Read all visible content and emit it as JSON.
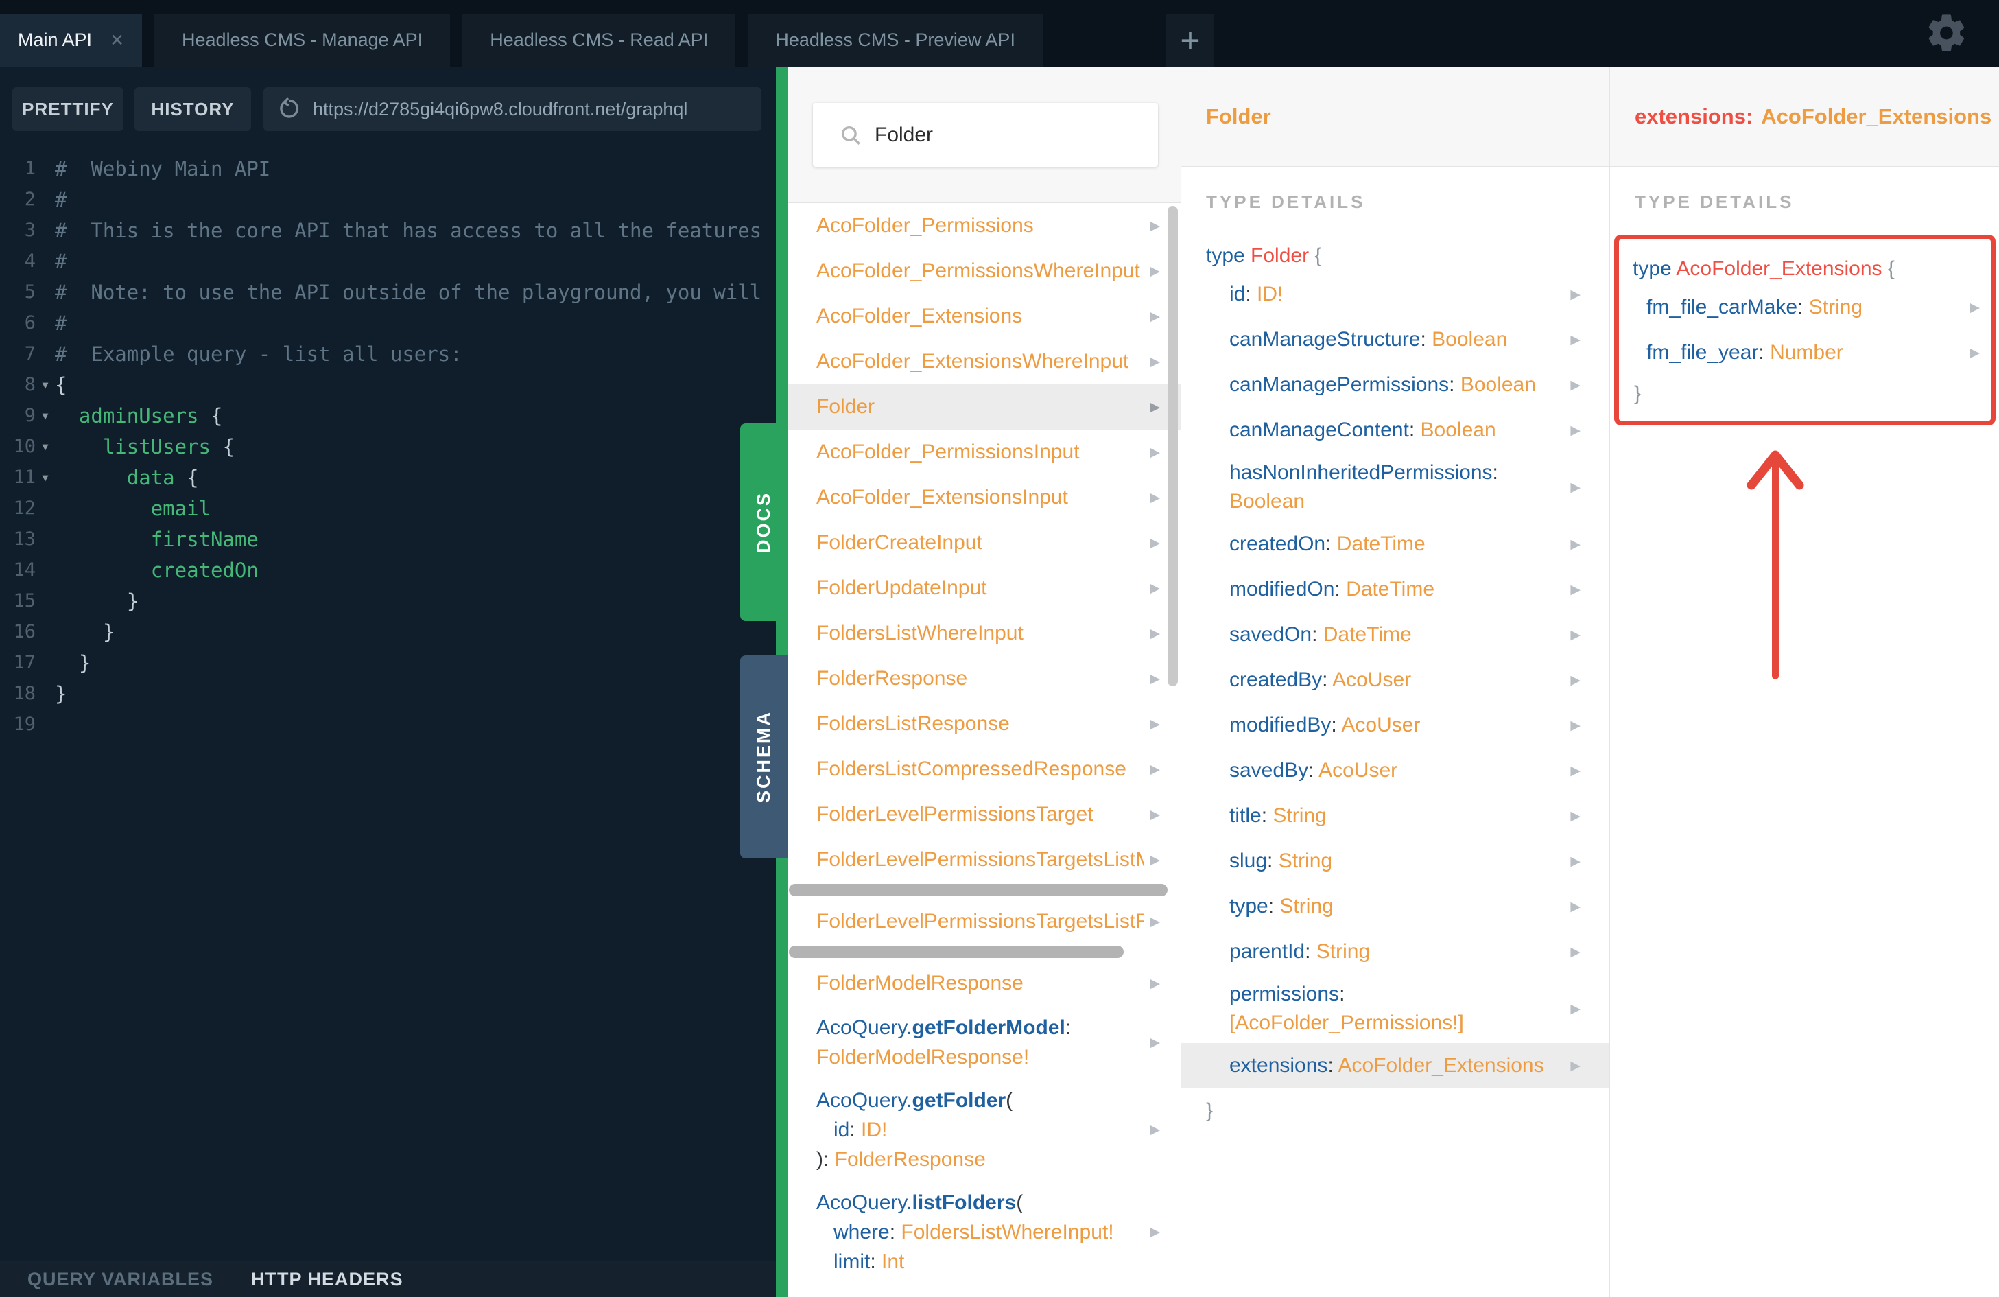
{
  "colors": {
    "green": "#2aa35f",
    "schema": "#3e5973",
    "orange": "#ed9c42",
    "blue": "#1f61a0",
    "red": "#f04e42",
    "boxred": "#e8463a",
    "editor-bg": "#0f1e2a",
    "topbar-bg": "#0a131c",
    "panel-bg": "#f7f7f7",
    "sel": "#ececec",
    "codegreen": "#45b878",
    "comment": "#5f7484"
  },
  "glyphs": {
    "chevron": "▶",
    "fold": "▼",
    "close": "✕",
    "brace_open": "{",
    "brace_close": "}"
  },
  "topbar": {
    "tabs": [
      {
        "label": "Main API",
        "active": true,
        "closable": true
      },
      {
        "label": "Headless CMS - Manage API"
      },
      {
        "label": "Headless CMS - Read API"
      },
      {
        "label": "Headless CMS - Preview API"
      }
    ],
    "new_tab_label": "+"
  },
  "toolbar": {
    "prettify_label": "PRETTIFY",
    "history_label": "HISTORY",
    "url": "https://d2785gi4qi6pw8.cloudfront.net/graphql"
  },
  "editor": {
    "lines": [
      {
        "n": 1,
        "tokens": [
          {
            "t": "#  Webiny Main API",
            "c": "comment"
          }
        ]
      },
      {
        "n": 2,
        "tokens": [
          {
            "t": "#",
            "c": "comment"
          }
        ]
      },
      {
        "n": 3,
        "tokens": [
          {
            "t": "#  This is the core API that has access to all the features",
            "c": "comment"
          }
        ]
      },
      {
        "n": 4,
        "tokens": [
          {
            "t": "#",
            "c": "comment"
          }
        ]
      },
      {
        "n": 5,
        "tokens": [
          {
            "t": "#  Note: to use the API outside of the playground, you will",
            "c": "comment"
          }
        ]
      },
      {
        "n": 6,
        "tokens": [
          {
            "t": "#",
            "c": "comment"
          }
        ]
      },
      {
        "n": 7,
        "tokens": [
          {
            "t": "#  Example query - list all users:",
            "c": "comment"
          }
        ]
      },
      {
        "n": 8,
        "fold": true,
        "tokens": [
          {
            "t": "{",
            "c": "punct"
          }
        ]
      },
      {
        "n": 9,
        "fold": true,
        "tokens": [
          {
            "t": "  ",
            "c": "punct"
          },
          {
            "t": "adminUsers",
            "c": "green"
          },
          {
            "t": " {",
            "c": "punct"
          }
        ]
      },
      {
        "n": 10,
        "fold": true,
        "tokens": [
          {
            "t": "    ",
            "c": "punct"
          },
          {
            "t": "listUsers",
            "c": "green"
          },
          {
            "t": " {",
            "c": "punct"
          }
        ]
      },
      {
        "n": 11,
        "fold": true,
        "tokens": [
          {
            "t": "      ",
            "c": "punct"
          },
          {
            "t": "data",
            "c": "green"
          },
          {
            "t": " {",
            "c": "punct"
          }
        ]
      },
      {
        "n": 12,
        "tokens": [
          {
            "t": "        ",
            "c": "punct"
          },
          {
            "t": "email",
            "c": "green"
          }
        ]
      },
      {
        "n": 13,
        "tokens": [
          {
            "t": "        ",
            "c": "punct"
          },
          {
            "t": "firstName",
            "c": "green"
          }
        ]
      },
      {
        "n": 14,
        "tokens": [
          {
            "t": "        ",
            "c": "punct"
          },
          {
            "t": "createdOn",
            "c": "green"
          }
        ]
      },
      {
        "n": 15,
        "tokens": [
          {
            "t": "      }",
            "c": "punct"
          }
        ]
      },
      {
        "n": 16,
        "tokens": [
          {
            "t": "    }",
            "c": "punct"
          }
        ]
      },
      {
        "n": 17,
        "tokens": [
          {
            "t": "  }",
            "c": "punct"
          }
        ]
      },
      {
        "n": 18,
        "tokens": [
          {
            "t": "}",
            "c": "punct"
          }
        ]
      },
      {
        "n": 19,
        "tokens": []
      }
    ]
  },
  "bottom_bar": {
    "query_variables": "QUERY VARIABLES",
    "http_headers": "HTTP HEADERS"
  },
  "side_tabs": {
    "docs": "DOCS",
    "schema": "SCHEMA"
  },
  "docs_panel": {
    "search_value": "Folder",
    "items": [
      {
        "kind": "type",
        "name": "AcoFolder_Permissions"
      },
      {
        "kind": "type",
        "name": "AcoFolder_PermissionsWhereInput"
      },
      {
        "kind": "type",
        "name": "AcoFolder_Extensions"
      },
      {
        "kind": "type",
        "name": "AcoFolder_ExtensionsWhereInput"
      },
      {
        "kind": "type",
        "name": "Folder",
        "selected": true
      },
      {
        "kind": "type",
        "name": "AcoFolder_PermissionsInput"
      },
      {
        "kind": "type",
        "name": "AcoFolder_ExtensionsInput"
      },
      {
        "kind": "type",
        "name": "FolderCreateInput"
      },
      {
        "kind": "type",
        "name": "FolderUpdateInput"
      },
      {
        "kind": "type",
        "name": "FoldersListWhereInput"
      },
      {
        "kind": "type",
        "name": "FolderResponse"
      },
      {
        "kind": "type",
        "name": "FoldersListResponse"
      },
      {
        "kind": "type",
        "name": "FoldersListCompressedResponse"
      },
      {
        "kind": "type",
        "name": "FolderLevelPermissionsTarget"
      },
      {
        "kind": "type",
        "name": "FolderLevelPermissionsTargetsListMeta",
        "hscroll": "long"
      },
      {
        "kind": "type",
        "name": "FolderLevelPermissionsTargetsListResponse",
        "hscroll": "short"
      },
      {
        "kind": "type",
        "name": "FolderModelResponse"
      },
      {
        "kind": "query",
        "lines": [
          [
            {
              "t": "AcoQuery.",
              "c": "blue"
            },
            {
              "t": "getFolderModel",
              "c": "bluebold"
            },
            {
              "t": ":",
              "c": "dark"
            }
          ],
          [
            {
              "t": "FolderModelResponse!",
              "c": "orange"
            }
          ]
        ]
      },
      {
        "kind": "query",
        "lines": [
          [
            {
              "t": "AcoQuery.",
              "c": "blue"
            },
            {
              "t": "getFolder",
              "c": "bluebold"
            },
            {
              "t": "(",
              "c": "dark"
            }
          ],
          [
            {
              "t": "   ",
              "c": "dark"
            },
            {
              "t": "id",
              "c": "blue"
            },
            {
              "t": ": ",
              "c": "dark"
            },
            {
              "t": "ID!",
              "c": "orange"
            }
          ],
          [
            {
              "t": "): ",
              "c": "dark"
            },
            {
              "t": "FolderResponse",
              "c": "orange"
            }
          ]
        ]
      },
      {
        "kind": "query",
        "lines": [
          [
            {
              "t": "AcoQuery.",
              "c": "blue"
            },
            {
              "t": "listFolders",
              "c": "bluebold"
            },
            {
              "t": "(",
              "c": "dark"
            }
          ],
          [
            {
              "t": "   ",
              "c": "dark"
            },
            {
              "t": "where",
              "c": "blue"
            },
            {
              "t": ": ",
              "c": "dark"
            },
            {
              "t": "FoldersListWhereInput!",
              "c": "orange"
            }
          ],
          [
            {
              "t": "   ",
              "c": "dark"
            },
            {
              "t": "limit",
              "c": "blue"
            },
            {
              "t": ": ",
              "c": "dark"
            },
            {
              "t": "Int",
              "c": "orange"
            }
          ]
        ]
      }
    ]
  },
  "type_panel": {
    "title": "Folder",
    "section": "TYPE DETAILS",
    "decl": {
      "keyword": "type ",
      "name": "Folder ",
      "brace": "{"
    },
    "fields": [
      {
        "name": "id",
        "type": "ID!"
      },
      {
        "name": "canManageStructure",
        "type": "Boolean"
      },
      {
        "name": "canManagePermissions",
        "type": "Boolean"
      },
      {
        "name": "canManageContent",
        "type": "Boolean"
      },
      {
        "name": "hasNonInheritedPermissions",
        "type": "Boolean"
      },
      {
        "name": "createdOn",
        "type": "DateTime"
      },
      {
        "name": "modifiedOn",
        "type": "DateTime"
      },
      {
        "name": "savedOn",
        "type": "DateTime"
      },
      {
        "name": "createdBy",
        "type": "AcoUser"
      },
      {
        "name": "modifiedBy",
        "type": "AcoUser"
      },
      {
        "name": "savedBy",
        "type": "AcoUser"
      },
      {
        "name": "title",
        "type": "String"
      },
      {
        "name": "slug",
        "type": "String"
      },
      {
        "name": "type",
        "type": "String"
      },
      {
        "name": "parentId",
        "type": "String"
      },
      {
        "name": "permissions",
        "type": "[AcoFolder_Permissions!]"
      },
      {
        "name": "extensions",
        "type": "AcoFolder_Extensions",
        "highlight": true
      }
    ],
    "close": "}"
  },
  "extensions_panel": {
    "title_field": "extensions:",
    "title_type": "AcoFolder_Extensions",
    "section": "TYPE DETAILS",
    "decl": {
      "keyword": "type ",
      "name": "AcoFolder_Extensions ",
      "brace": "{"
    },
    "fields": [
      {
        "name": "fm_file_carMake",
        "type": "String"
      },
      {
        "name": "fm_file_year",
        "type": "Number"
      }
    ],
    "close": "}"
  }
}
